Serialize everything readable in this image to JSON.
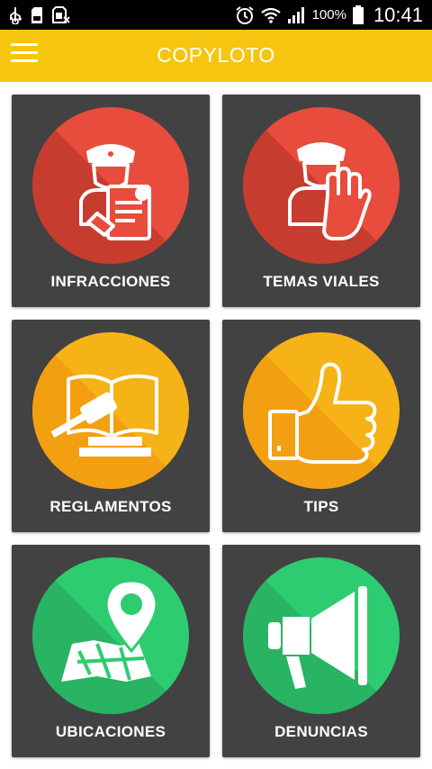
{
  "status_bar": {
    "battery_percent": "100%",
    "time": "10:41",
    "icons": [
      "usb-icon",
      "sd-card-icon",
      "sim-off-icon",
      "alarm-icon",
      "wifi-icon",
      "signal-icon",
      "battery-icon"
    ]
  },
  "app_bar": {
    "title": "COPYLOTO",
    "menu_icon": "hamburger-menu-icon"
  },
  "tiles": [
    {
      "label": "INFRACCIONES",
      "icon": "officer-ticket-icon",
      "color": "#e74c3c"
    },
    {
      "label": "TEMAS VIALES",
      "icon": "officer-stop-hand-icon",
      "color": "#e74c3c"
    },
    {
      "label": "REGLAMENTOS",
      "icon": "book-gavel-icon",
      "color": "#f5b318"
    },
    {
      "label": "TIPS",
      "icon": "thumbs-up-icon",
      "color": "#f5b318"
    },
    {
      "label": "UBICACIONES",
      "icon": "map-pin-icon",
      "color": "#2ecc71"
    },
    {
      "label": "DENUNCIAS",
      "icon": "megaphone-icon",
      "color": "#2ecc71"
    }
  ],
  "colors": {
    "app_bar": "#f6c510",
    "tile_background": "#424242",
    "red": "#e74c3c",
    "yellow": "#f5b318",
    "green": "#2ecc71"
  }
}
